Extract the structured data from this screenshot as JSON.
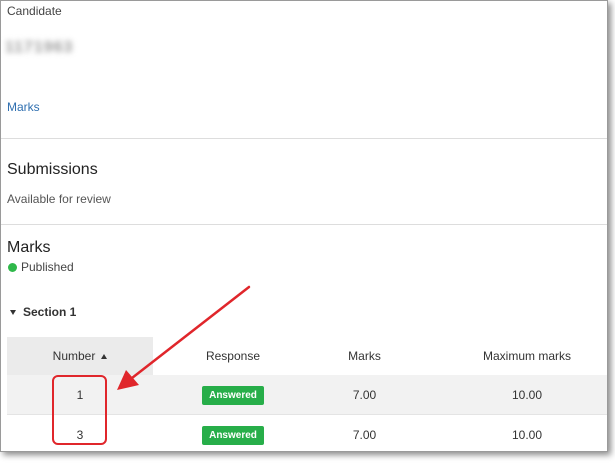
{
  "candidate": {
    "label": "Candidate",
    "id_blurred": "1171963",
    "marks_link": "Marks"
  },
  "submissions": {
    "heading": "Submissions",
    "status_text": "Available for review"
  },
  "marks": {
    "heading": "Marks",
    "status": "Published",
    "status_color": "#2fb84a",
    "section_label": "Section 1",
    "table": {
      "columns": [
        "Number",
        "Response",
        "Marks",
        "Maximum marks"
      ],
      "rows": [
        {
          "number": "1",
          "response": "Answered",
          "marks": "7.00",
          "maximum": "10.00"
        },
        {
          "number": "3",
          "response": "Answered",
          "marks": "7.00",
          "maximum": "10.00"
        }
      ]
    }
  },
  "colors": {
    "accent_link": "#2f6fb0",
    "badge": "#27ae49",
    "annotation": "#e0262b"
  }
}
